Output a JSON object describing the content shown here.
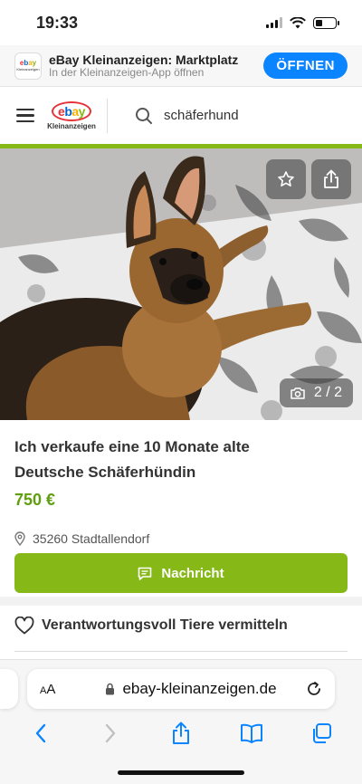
{
  "status_bar": {
    "time": "19:33"
  },
  "app_banner": {
    "title": "eBay Kleinanzeigen: Marktplatz",
    "subtitle": "In der Kleinanzeigen-App öffnen",
    "open_label": "ÖFFNEN"
  },
  "header": {
    "logo_text": "ebay",
    "logo_subtext": "Kleinanzeigen",
    "search_value": "schäferhund"
  },
  "gallery": {
    "counter": "2 / 2"
  },
  "listing": {
    "title": "Ich verkaufe eine 10 Monate alte Deutsche Schäferhündin",
    "price": "750 €",
    "location": "35260 Stadtallendorf",
    "message_button": "Nachricht"
  },
  "info": {
    "responsibly_label": "Verantwortungsvoll Tiere vermitteln"
  },
  "safari": {
    "text_size_label": "AA",
    "url": "ebay-kleinanzeigen.de"
  },
  "colors": {
    "brand_green": "#86b817",
    "price_green": "#5f9f0f",
    "ios_blue": "#0a84ff"
  }
}
